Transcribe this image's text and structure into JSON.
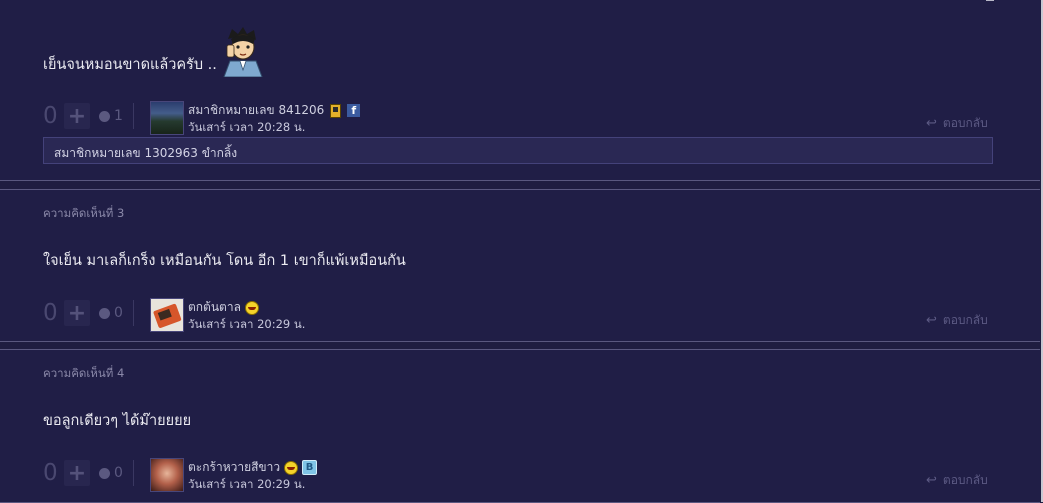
{
  "comments": [
    {
      "label": "",
      "text": "เย็นจนหมอนขาดแล้วครับ ..",
      "score": "0",
      "emotion_count": "1",
      "username": "สมาชิกหมายเลข 841206",
      "time": "วันเสาร์ เวลา 20:28 น.",
      "reply_label": "ตอบกลับ",
      "sub_reply": "สมาชิกหมายเลข 1302963 ขำกลิ้ง"
    },
    {
      "label": "ความคิดเห็นที่ 3",
      "text": "ใจเย็น มาเลก็เกร็ง เหมือนกัน โดน อีก 1 เขาก็แพ้เหมือนกัน",
      "score": "0",
      "emotion_count": "0",
      "username": "ตกต้นตาล",
      "time": "วันเสาร์ เวลา 20:29 น.",
      "reply_label": "ตอบกลับ"
    },
    {
      "label": "ความคิดเห็นที่ 4",
      "text": "ขอลูกเดียวๆ ได้ม๊ายยยย",
      "score": "0",
      "emotion_count": "0",
      "username": "ตะกร้าหวายสีขาว",
      "time": "วันเสาร์ เวลา 20:29 น.",
      "reply_label": "ตอบกลับ"
    }
  ],
  "badges": {
    "facebook_letter": "f",
    "blog_letter": "B"
  },
  "icons": {
    "plus": "plus-icon",
    "emotion": "emotion-face-icon",
    "reply": "reply-arrow-icon",
    "smiley": "laughing-smiley-icon",
    "facebook": "facebook-icon",
    "mobile": "mobile-phone-icon",
    "blog": "blog-icon"
  },
  "colors": {
    "background": "#1f1d41",
    "card": "#201e46",
    "muted": "#5c5a84"
  }
}
